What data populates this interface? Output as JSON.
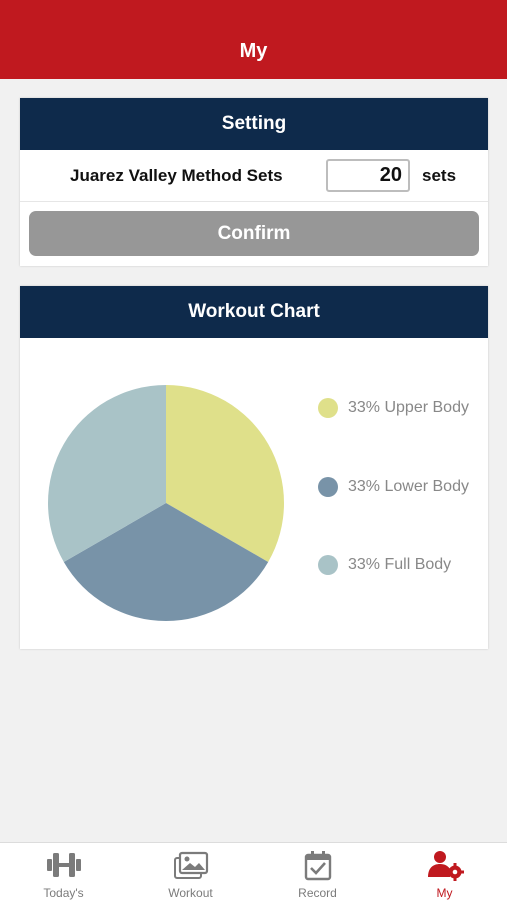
{
  "header": {
    "title": "My"
  },
  "setting": {
    "title": "Setting",
    "method_label": "Juarez Valley Method Sets",
    "sets_value": "20",
    "sets_unit": "sets",
    "confirm_label": "Confirm"
  },
  "chart": {
    "title": "Workout Chart",
    "legend": [
      {
        "label": "33% Upper Body",
        "color": "#dfe08a"
      },
      {
        "label": "33% Lower Body",
        "color": "#7893a8"
      },
      {
        "label": "33% Full Body",
        "color": "#a9c3c7"
      }
    ]
  },
  "chart_data": {
    "type": "pie",
    "categories": [
      "Upper Body",
      "Lower Body",
      "Full Body"
    ],
    "values": [
      33,
      33,
      33
    ],
    "colors": [
      "#dfe08a",
      "#7893a8",
      "#a9c3c7"
    ],
    "legend_position": "right"
  },
  "tabbar": {
    "items": [
      {
        "label": "Today's",
        "icon": "dumbbell-icon",
        "active": false
      },
      {
        "label": "Workout",
        "icon": "photo-gallery-icon",
        "active": false
      },
      {
        "label": "Record",
        "icon": "calendar-check-icon",
        "active": false
      },
      {
        "label": "My",
        "icon": "user-gear-icon",
        "active": true
      }
    ]
  },
  "colors": {
    "brand_red": "#c0191f",
    "navy": "#0e2a4b",
    "button_gray": "#979797"
  }
}
